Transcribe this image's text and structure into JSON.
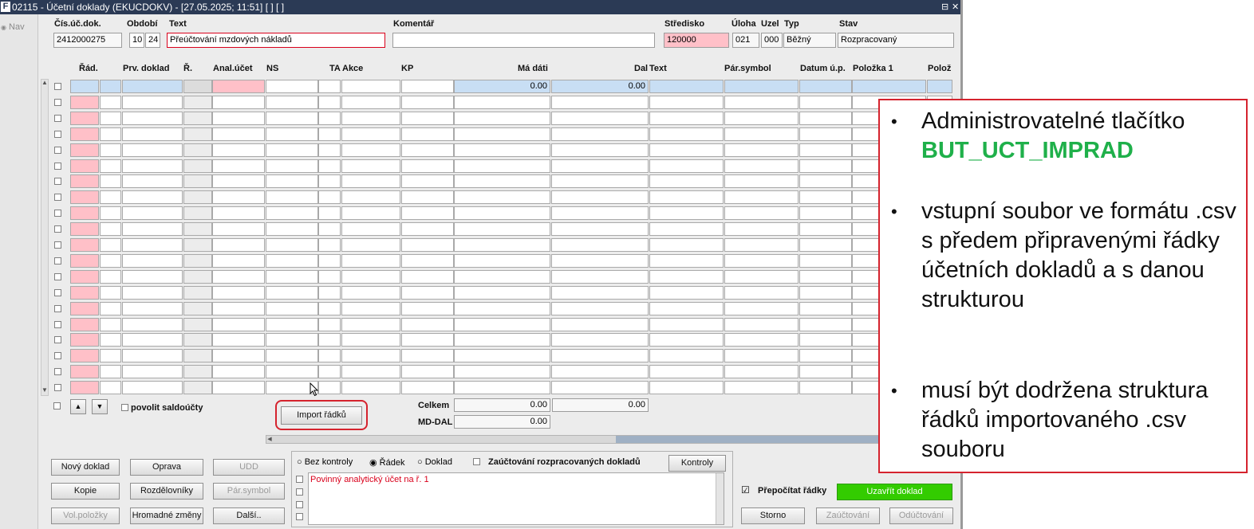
{
  "window": {
    "app_icon": "F",
    "title": "02115 - Účetní doklady (EKUCDOKV) - [27.05.2025; 11:51]  [ ]  [ ]",
    "restore_glyph": "⊟",
    "close_glyph": "✕",
    "nav_label": "Nav"
  },
  "header": {
    "labels": {
      "doc_no": "Čís.úč.dok.",
      "period": "Období",
      "text": "Text",
      "comment": "Komentář",
      "cost_center": "Středisko",
      "task": "Úloha",
      "node": "Uzel",
      "type": "Typ",
      "state": "Stav"
    },
    "values": {
      "doc_no": "2412000275",
      "period_month": "10",
      "period_year": "24",
      "text": "Přeúčtování mzdových nákladů",
      "comment": "",
      "cost_center": "120000",
      "task": "021",
      "node": "000",
      "type": "Běžný",
      "state": "Rozpracovaný"
    }
  },
  "grid": {
    "columns": [
      "Řád.",
      "Prv. doklad",
      "Ř.",
      "Anal.účet",
      "NS",
      "TA",
      "Akce",
      "KP",
      "Má dáti",
      "Dal",
      "Text",
      "Pár.symbol",
      "Datum ú.p.",
      "Položka 1",
      "Polož"
    ],
    "first_row": {
      "debit": "0.00",
      "credit": "0.00"
    },
    "row_count": 20
  },
  "footer_grid": {
    "saldo_label": "povolit saldoúčty",
    "import_button": "Import řádků",
    "total_label": "Celkem",
    "total_debit": "0.00",
    "total_credit": "0.00",
    "mddal_label": "MD-DAL",
    "mddal_value": "0.00"
  },
  "buttons": {
    "new_doc": "Nový doklad",
    "edit": "Oprava",
    "udd": "UDD",
    "copy": "Kopie",
    "distributors": "Rozdělovníky",
    "pair_symbol": "Pár.symbol",
    "free_items": "Vol.položky",
    "bulk_changes": "Hromadné změny",
    "more": "Další..",
    "checks": "Kontroly",
    "close_doc": "Uzavřít doklad",
    "storno": "Storno",
    "post": "Zaúčtování",
    "unpost": "Odúčtování"
  },
  "control_panel": {
    "radio_none": "Bez kontroly",
    "radio_row": "Řádek",
    "radio_doc": "Doklad",
    "post_drafts": "Zaúčtování rozpracovaných dokladů",
    "messages": [
      "Povinný analytický účet na ř. 1"
    ],
    "recalc_label": "Přepočítat řádky"
  },
  "callout": {
    "items": [
      {
        "text": "Administrovatelné tlačítko",
        "highlight": "BUT_UCT_IMPRAD"
      },
      {
        "text": "vstupní soubor ve formátu .csv s předem připravenými řádky účetních dokladů a s danou strukturou",
        "highlight": ""
      },
      {
        "text": "musí být dodržena struktura řádků importovaného .csv souboru",
        "highlight": ""
      }
    ],
    "bullet": "•"
  },
  "colors": {
    "titlebar": "#2b3a55",
    "required_field": "#ffc0c8",
    "current_row": "#c8def4",
    "close_button": "#33cc00",
    "callout_border": "#d5232e",
    "highlight_text": "#1fb04a",
    "error_text": "#d9001b"
  }
}
